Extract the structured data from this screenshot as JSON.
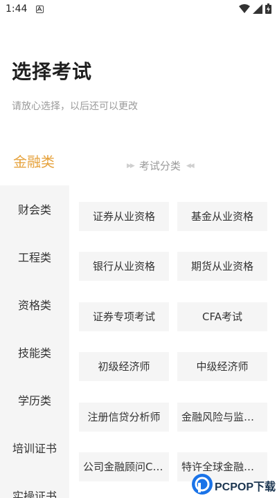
{
  "status_bar": {
    "time": "1:44"
  },
  "header": {
    "title": "选择考试",
    "subtitle": "请放心选择，以后还可以更改"
  },
  "category_header": {
    "active_category": "金融类",
    "section_label": "考试分类"
  },
  "sidebar": {
    "items": [
      {
        "label": "财会类"
      },
      {
        "label": "工程类"
      },
      {
        "label": "资格类"
      },
      {
        "label": "技能类"
      },
      {
        "label": "学历类"
      },
      {
        "label": "培训证书"
      },
      {
        "label": "实操证书"
      }
    ]
  },
  "exams": [
    {
      "label": "证券从业资格"
    },
    {
      "label": "基金从业资格"
    },
    {
      "label": "银行从业资格"
    },
    {
      "label": "期货从业资格"
    },
    {
      "label": "证券专项考试"
    },
    {
      "label": "CFA考试"
    },
    {
      "label": "初级经济师"
    },
    {
      "label": "中级经济师"
    },
    {
      "label": "注册信贷分析师"
    },
    {
      "label": "金融风险与监管…"
    },
    {
      "label": "公司金融顾问CFC"
    },
    {
      "label": "特许全球金融科…"
    }
  ],
  "watermark": {
    "text": "PCPOP下载"
  },
  "colors": {
    "accent": "#e6a23c",
    "sidebar_bg": "#f5f5f5",
    "button_bg": "#f5f5f5",
    "muted_text": "#9a9a9a"
  }
}
